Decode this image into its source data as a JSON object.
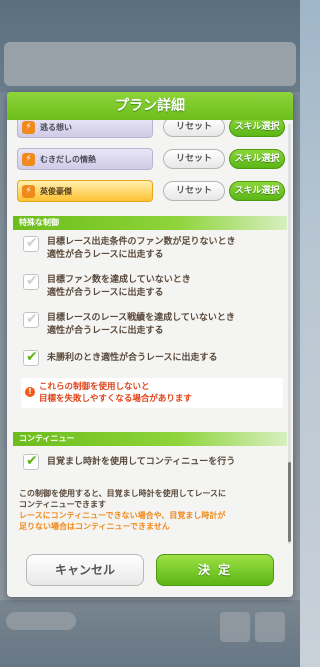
{
  "dialog": {
    "title": "プラン詳細",
    "cancel_label": "キャンセル",
    "decide_label": "決 定"
  },
  "skills": [
    {
      "name": "逃る想い",
      "reset_label": "リセット",
      "select_label": "スキル選択",
      "style": "normal"
    },
    {
      "name": "むきだしの情熱",
      "reset_label": "リセット",
      "select_label": "スキル選択",
      "style": "normal"
    },
    {
      "name": "英俊豪傑",
      "reset_label": "リセット",
      "select_label": "スキル選択",
      "style": "gold"
    }
  ],
  "special_control": {
    "header": "特殊な制御",
    "options": [
      {
        "line1": "目標レース出走条件のファン数が足りないとき",
        "line2": "適性が合うレースに出走する",
        "checked": false
      },
      {
        "line1": "目標ファン数を達成していないとき",
        "line2": "適性が合うレースに出走する",
        "checked": false
      },
      {
        "line1": "目標レースのレース戦績を達成していないとき",
        "line2": "適性が合うレースに出走する",
        "checked": false
      },
      {
        "line1": "未勝利のとき適性が合うレースに出走する",
        "line2": "",
        "checked": true
      }
    ],
    "warning_line1": "これらの制御を使用しないと",
    "warning_line2": "目標を失敗しやすくなる場合があります"
  },
  "continue": {
    "header": "コンティニュー",
    "option": "目覚まし時計を使用してコンティニューを行う",
    "info_line1": "この制御を使用すると、目覚まし時計を使用してレースに",
    "info_line2": "コンティニューできます",
    "info_orange_line1": "レースにコンティニューできない場合や、目覚まし時計が",
    "info_orange_line2": "足りない場合はコンティニューできません"
  },
  "colors": {
    "accent_green": "#6dbd1c",
    "warning_red": "#e0441c",
    "info_orange": "#f08a1c"
  }
}
